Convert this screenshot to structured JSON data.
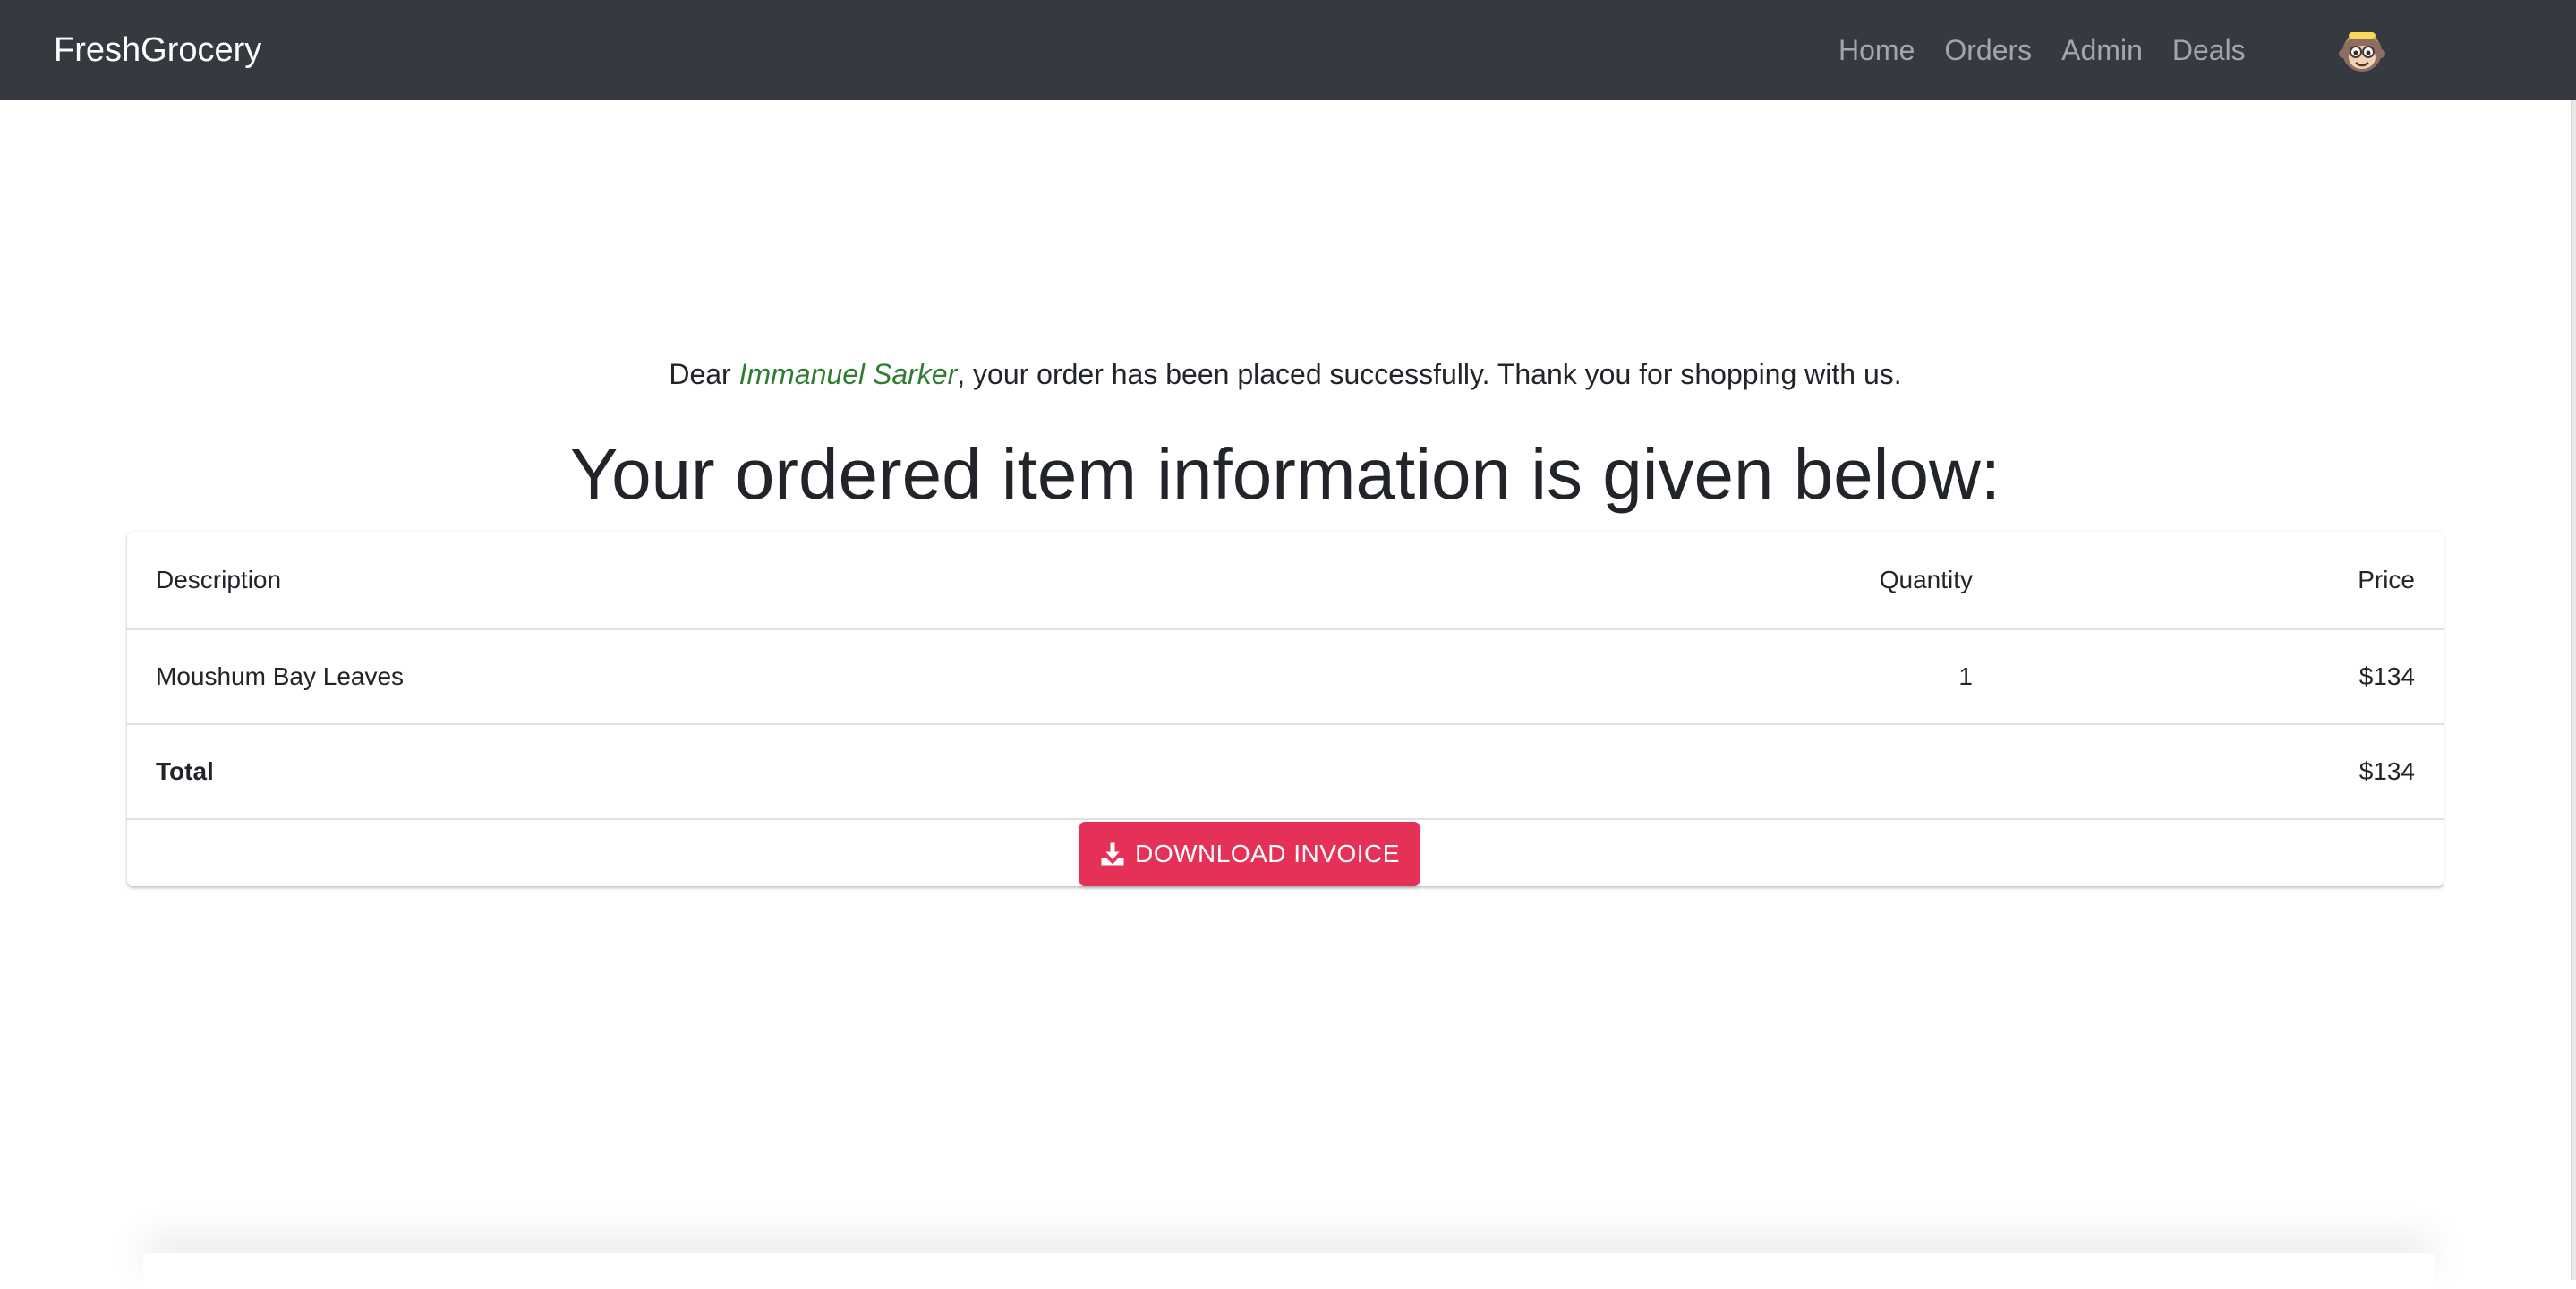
{
  "navbar": {
    "brand": "FreshGrocery",
    "links": [
      "Home",
      "Orders",
      "Admin",
      "Deals"
    ],
    "avatar_icon": "monkey-avatar-icon"
  },
  "confirmation": {
    "prefix": "Dear ",
    "customer_name": "Immanuel Sarker",
    "suffix": ", your order has been placed successfully. Thank you for shopping with us.",
    "heading": "Your ordered item information is given below:"
  },
  "table": {
    "headers": {
      "description": "Description",
      "quantity": "Quantity",
      "price": "Price"
    },
    "items": [
      {
        "description": "Moushum Bay Leaves",
        "quantity": "1",
        "price": "$134"
      }
    ],
    "total_label": "Total",
    "total_price": "$134"
  },
  "download_button": {
    "label": "DOWNLOAD INVOICE",
    "icon": "download-icon"
  },
  "colors": {
    "navbar_bg": "#343a40",
    "customer_name": "#2e7d32",
    "download_button_bg": "#e53158"
  }
}
